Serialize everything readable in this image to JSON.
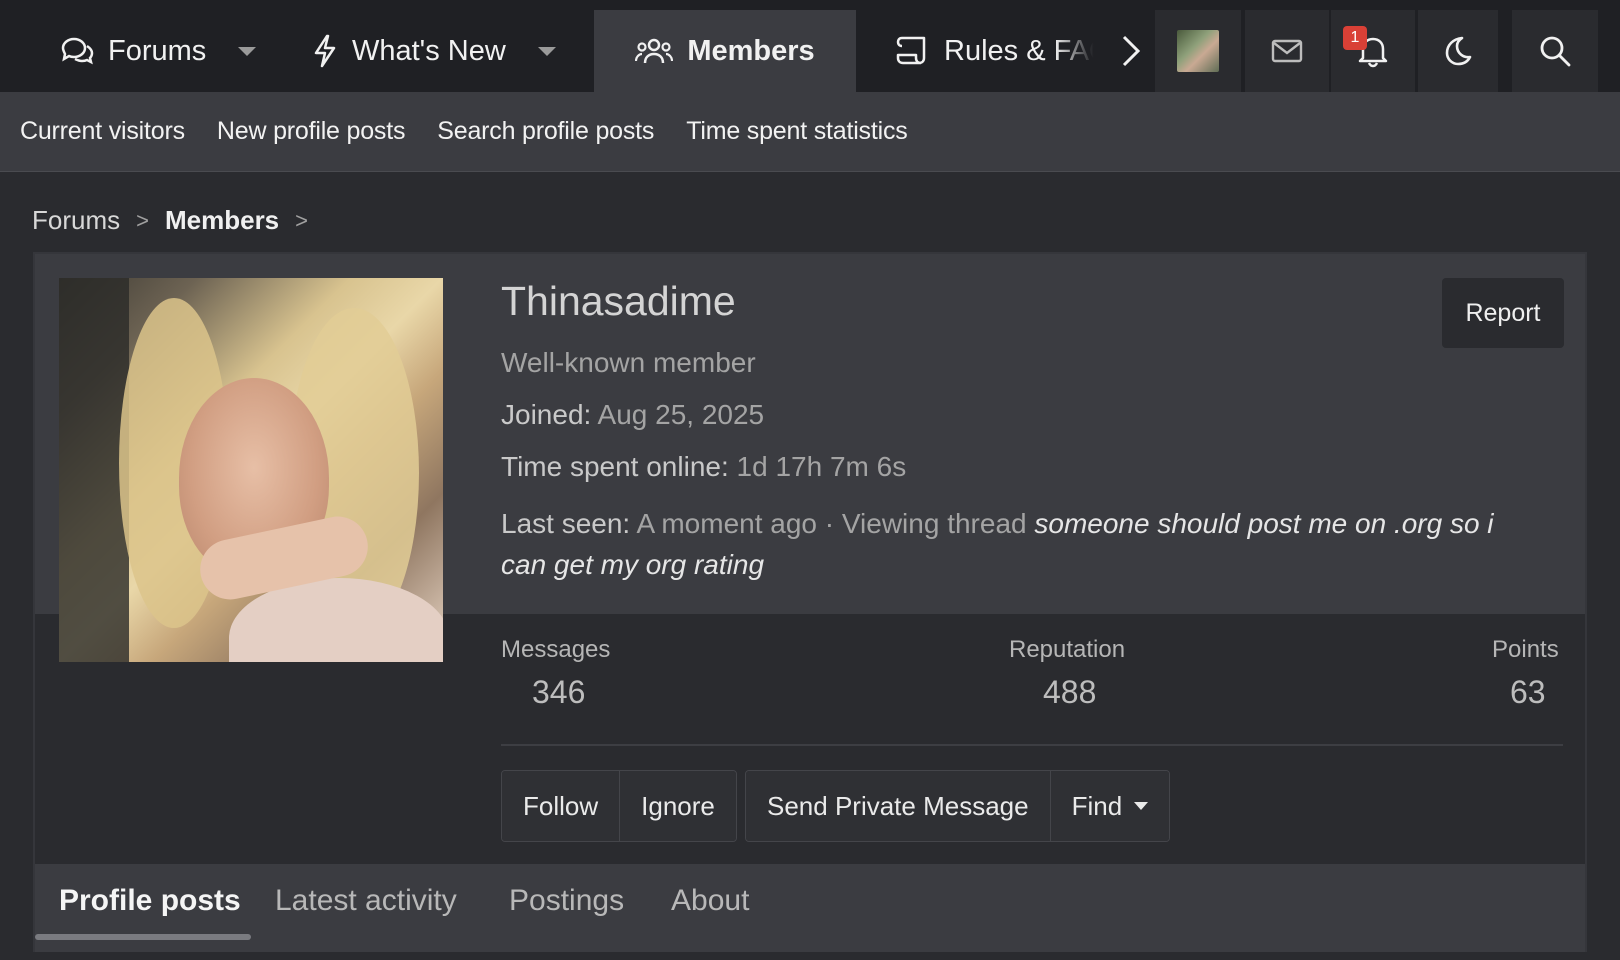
{
  "nav": {
    "tabs": [
      {
        "label": "Forums",
        "icon": "chat-bubbles-icon"
      },
      {
        "label": "What's New",
        "icon": "lightning-icon"
      },
      {
        "label": "Members",
        "icon": "people-icon"
      },
      {
        "label": "Rules & FAQ",
        "icon": "scroll-icon"
      }
    ],
    "notification_count": "1",
    "icons": [
      "avatar",
      "envelope-icon",
      "bell-icon",
      "moon-icon",
      "search-icon"
    ]
  },
  "subnav": [
    "Current visitors",
    "New profile posts",
    "Search profile posts",
    "Time spent statistics"
  ],
  "breadcrumb": {
    "root": "Forums",
    "current": "Members"
  },
  "profile": {
    "username": "Thinasadime",
    "title": "Well-known member",
    "joined_label": "Joined:",
    "joined": "Aug 25, 2025",
    "online_label": "Time spent online:",
    "online": "1d 17h 7m 6s",
    "lastseen_label": "Last seen:",
    "lastseen": "A moment ago · Viewing thread",
    "thread_line1": "someone should post me on .org so i",
    "thread_line2": "can get my org rating",
    "report": "Report",
    "stats": {
      "messages_label": "Messages",
      "messages": "346",
      "reputation_label": "Reputation",
      "reputation": "488",
      "points_label": "Points",
      "points": "63"
    },
    "buttons": {
      "follow": "Follow",
      "ignore": "Ignore",
      "pm": "Send Private Message",
      "find": "Find"
    }
  },
  "tabs": [
    "Profile posts",
    "Latest activity",
    "Postings",
    "About"
  ],
  "colors": {
    "badge": "#d94036",
    "nav_bg": "#1f2024",
    "active_tab": "#3b3c41"
  }
}
